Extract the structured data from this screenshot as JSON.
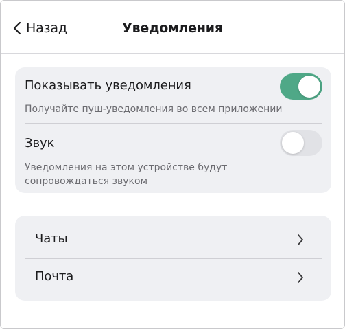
{
  "header": {
    "back_label": "Назад",
    "title": "Уведомления"
  },
  "settings": {
    "show_notifications": {
      "label": "Показывать уведомления",
      "description": "Получайте пуш-уведомления во всем приложении",
      "enabled": true
    },
    "sound": {
      "label": "Звук",
      "description_line1": "Уведомления на этом устройстве будут",
      "description_line2": "сопровождаться звуком",
      "enabled": false
    }
  },
  "channels": {
    "items": [
      {
        "label": "Чаты",
        "icon": "chevron-right-icon"
      },
      {
        "label": "Почта",
        "icon": "chevron-right-icon"
      }
    ]
  },
  "colors": {
    "toggle_on": "#4fa887",
    "toggle_off": "#e1e2e6",
    "group_bg": "#eff0f3"
  }
}
